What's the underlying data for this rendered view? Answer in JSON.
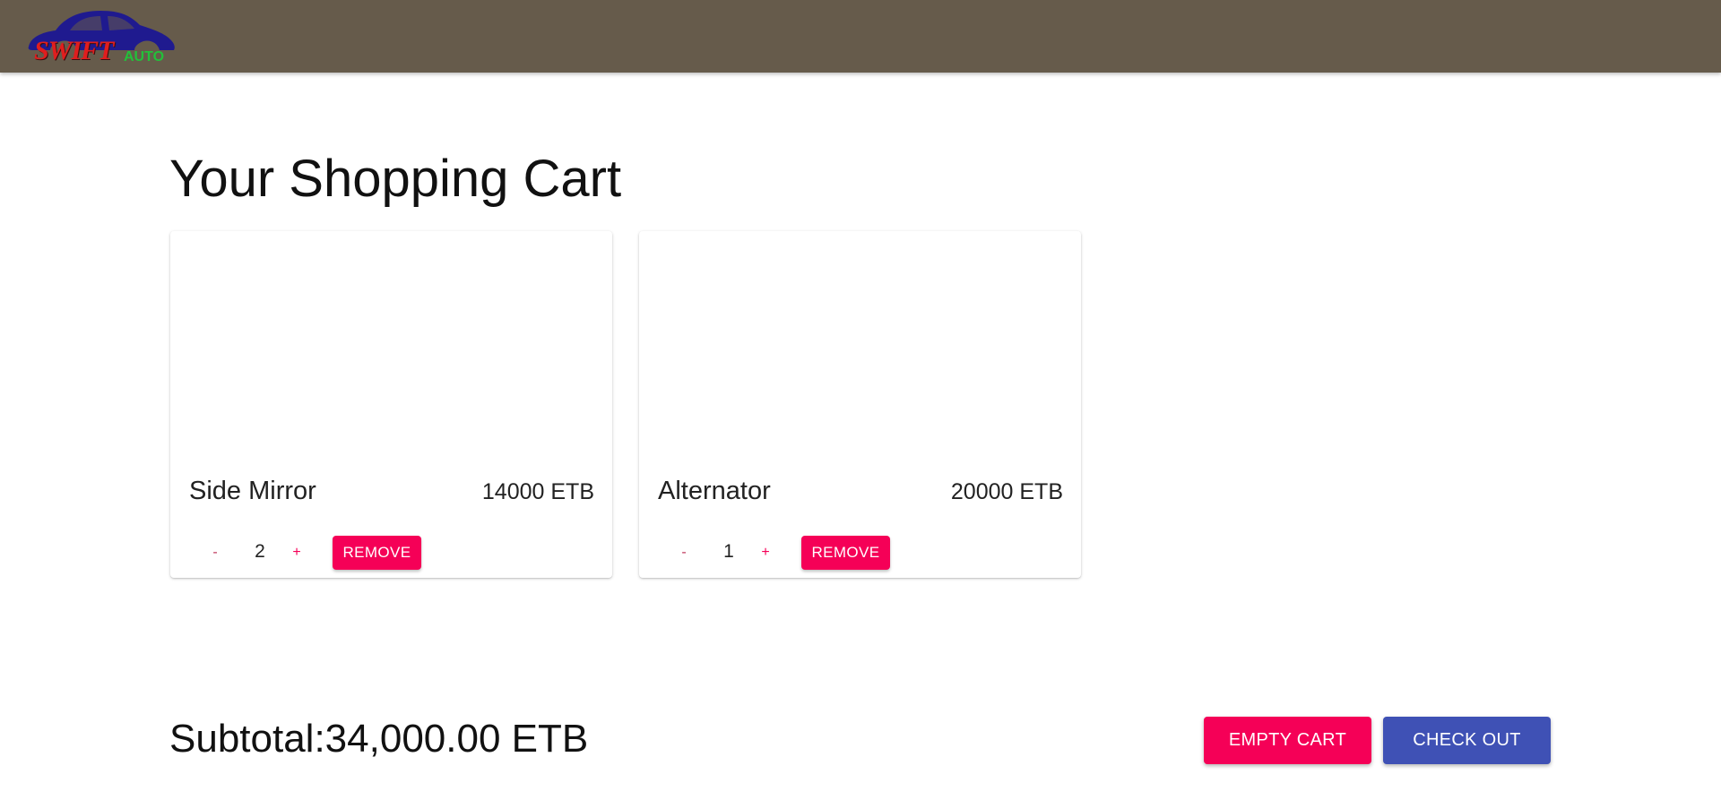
{
  "brand": {
    "logo_text_main": "SWIFT",
    "logo_text_sub": "AUTO",
    "appbar_color": "#665b4b",
    "logo_car_color": "#1f1a8f",
    "logo_main_color": "#e01e1e",
    "logo_sub_color": "#22c03a"
  },
  "page": {
    "title": "Your Shopping Cart"
  },
  "cart": {
    "items": [
      {
        "name": "Side Mirror",
        "price": "14000 ETB",
        "quantity": "2",
        "decrement_label": "-",
        "increment_label": "+",
        "remove_label": "REMOVE"
      },
      {
        "name": "Alternator",
        "price": "20000 ETB",
        "quantity": "1",
        "decrement_label": "-",
        "increment_label": "+",
        "remove_label": "REMOVE"
      }
    ]
  },
  "summary": {
    "subtotal": "Subtotal:34,000.00 ETB",
    "empty_cart_label": "EMPTY CART",
    "checkout_label": "CHECK OUT"
  },
  "colors": {
    "secondary": "#f50057",
    "primary": "#3f51b5"
  }
}
